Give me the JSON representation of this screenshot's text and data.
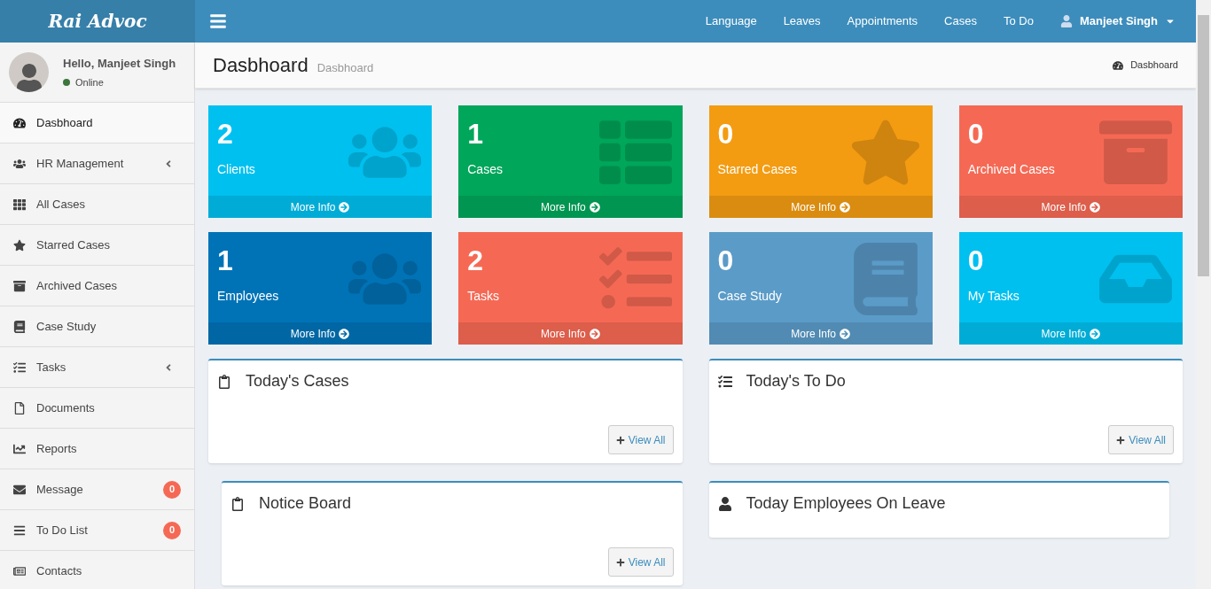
{
  "brand": "Rai Advoc",
  "nav": [
    "Language",
    "Leaves",
    "Appointments",
    "Cases",
    "To Do"
  ],
  "user_menu": "Manjeet Singh",
  "user_panel": {
    "greeting": "Hello, Manjeet Singh",
    "status": "Online"
  },
  "sidebar": [
    {
      "label": "Dasbhoard",
      "kind": "gauge",
      "selected": true
    },
    {
      "label": "HR Management",
      "kind": "users",
      "selected": false,
      "submenu": true
    },
    {
      "label": "All Cases",
      "kind": "grid",
      "selected": false
    },
    {
      "label": "Starred Cases",
      "kind": "star",
      "selected": false
    },
    {
      "label": "Archived Cases",
      "kind": "archive",
      "selected": false
    },
    {
      "label": "Case Study",
      "kind": "book",
      "selected": false
    },
    {
      "label": "Tasks",
      "kind": "tasks",
      "selected": false,
      "submenu": true
    },
    {
      "label": "Documents",
      "kind": "file",
      "selected": false
    },
    {
      "label": "Reports",
      "kind": "chart",
      "selected": false
    },
    {
      "label": "Message",
      "kind": "envelope",
      "selected": false,
      "badge": "0"
    },
    {
      "label": "To Do List",
      "kind": "bars",
      "selected": false,
      "badge": "0"
    },
    {
      "label": "Contacts",
      "kind": "card",
      "selected": false
    }
  ],
  "page": {
    "title": "Dasbhoard",
    "subtitle": "Dasbhoard",
    "breadcrumb": "Dasbhoard"
  },
  "tiles": [
    {
      "count": "2",
      "label": "Clients",
      "link": "More Info",
      "kind": "users",
      "color": "#00c0ef"
    },
    {
      "count": "1",
      "label": "Cases",
      "link": "More Info",
      "kind": "list",
      "color": "#00a65a"
    },
    {
      "count": "0",
      "label": "Starred Cases",
      "link": "More Info",
      "kind": "star",
      "color": "#f39c12"
    },
    {
      "count": "0",
      "label": "Archived Cases",
      "link": "More Info",
      "kind": "archive",
      "color": "#f56954"
    },
    {
      "count": "1",
      "label": "Employees",
      "link": "More Info",
      "kind": "users",
      "color": "#0073b7"
    },
    {
      "count": "2",
      "label": "Tasks",
      "link": "More Info",
      "kind": "tasks",
      "color": "#f56954"
    },
    {
      "count": "0",
      "label": "Case Study",
      "link": "More Info",
      "kind": "book",
      "color": "#5b9bc8"
    },
    {
      "count": "0",
      "label": "My Tasks",
      "link": "More Info",
      "kind": "inbox",
      "color": "#00c0ef"
    }
  ],
  "panels": [
    {
      "title": "Today's Cases",
      "kind": "clipboard",
      "button": "View All"
    },
    {
      "title": "Today's To Do",
      "kind": "tasks",
      "button": "View All"
    },
    {
      "title": "Notice Board",
      "kind": "clipboard",
      "button": "View All"
    },
    {
      "title": "Today Employees On Leave",
      "kind": "user"
    }
  ]
}
